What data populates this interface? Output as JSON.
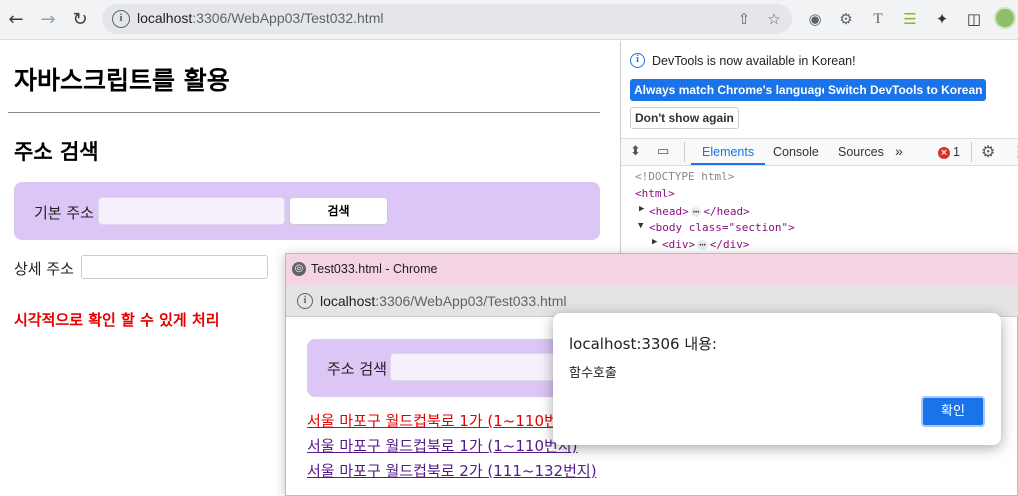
{
  "browser": {
    "url_host": "localhost",
    "url_path": ":3306/WebApp03/Test032.html"
  },
  "page": {
    "title": "자바스크립트를 활용",
    "section_title": "주소 검색",
    "basic_addr_label": "기본 주소",
    "search_button": "검색",
    "detail_addr_label": "상세 주소",
    "note": "시각적으로 확인 할 수 있게 처리"
  },
  "devtools": {
    "banner": "DevTools is now available in Korean!",
    "btn_match": "Always match Chrome's language",
    "btn_switch": "Switch DevTools to Korean",
    "btn_dont": "Don't show again",
    "tabs": [
      "Elements",
      "Console",
      "Sources"
    ],
    "error_count": "1",
    "code": [
      "<!DOCTYPE html>",
      "<html>",
      "<head>",
      "</head>",
      "<body class=\"section\">",
      "<div>",
      "</div>"
    ]
  },
  "popup": {
    "title": "Test033.html - Chrome",
    "url_host": "localhost",
    "url_path": ":3306/WebApp03/Test033.html",
    "search_label": "주소 검색",
    "links": [
      "서울 마포구 월드컵북로 1가 (1~110번지)",
      "서울 마포구 월드컵북로 1가 (1~110번지)",
      "서울 마포구 월드컵북로 2가 (111~132번지)"
    ]
  },
  "alert": {
    "host": "localhost:3306",
    "suffix": " 내용:",
    "message": "함수호출",
    "ok": "확인"
  }
}
